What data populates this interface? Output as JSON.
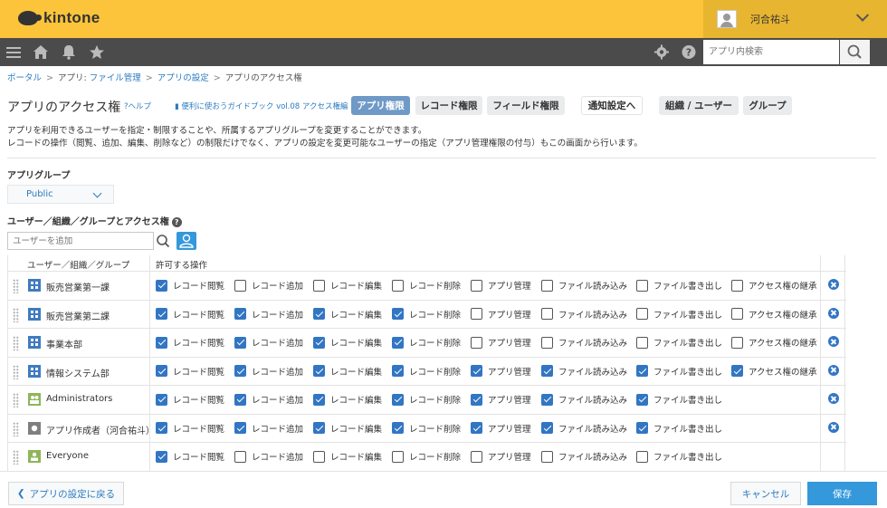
{
  "header": {
    "logo_text": "kintone",
    "user_name": "河合祐斗",
    "search_placeholder": "アプリ内検索"
  },
  "icons": [
    "menu-icon",
    "home-icon",
    "bell-icon",
    "star-icon",
    "gear-icon",
    "help-icon",
    "search-icon",
    "chevron-down-icon",
    "user-avatar-icon"
  ],
  "breadcrumb": {
    "portal": "ポータル",
    "app_prefix": "アプリ:",
    "app_name": "ファイル管理",
    "settings": "アプリの設定",
    "current": "アプリのアクセス権",
    "separator": ">"
  },
  "page": {
    "title": "アプリのアクセス権",
    "help": "?ヘルプ",
    "guide": "便利に使おうガイドブック vol.08 アクセス権編",
    "description_line1": "アプリを利用できるユーザーを指定・制限することや、所属するアプリグループを変更することができます。",
    "description_line2": "レコードの操作（閲覧、追加、編集、削除など）の制限だけでなく、アプリの設定を変更可能なユーザーの指定（アプリ管理権限の付与）もこの画面から行います。"
  },
  "tabs": [
    {
      "label": "アプリ権限",
      "active": true
    },
    {
      "label": "レコード権限",
      "active": false
    },
    {
      "label": "フィールド権限",
      "active": false
    },
    {
      "label": "通知設定へ",
      "active": false
    },
    {
      "label": "組織 / ユーザー",
      "active": false
    },
    {
      "label": "グループ",
      "active": false
    }
  ],
  "app_group": {
    "label": "アプリグループ",
    "selected": "Public"
  },
  "acl": {
    "label": "ユーザー／組織／グループとアクセス権",
    "add_placeholder": "ユーザーを追加",
    "col_entity": "ユーザー／組織／グループ",
    "col_perms": "許可する操作",
    "permissions": [
      "レコード閲覧",
      "レコード追加",
      "レコード編集",
      "レコード削除",
      "アプリ管理",
      "ファイル読み込み",
      "ファイル書き出し",
      "アクセス権の継承"
    ],
    "rows": [
      {
        "name": "販売営業第一課",
        "type": "org",
        "checks": [
          true,
          false,
          false,
          false,
          false,
          false,
          false,
          false
        ],
        "inherit": true,
        "deletable": true
      },
      {
        "name": "販売営業第二課",
        "type": "org",
        "checks": [
          true,
          true,
          true,
          true,
          false,
          false,
          false,
          false
        ],
        "inherit": true,
        "deletable": true
      },
      {
        "name": "事業本部",
        "type": "org",
        "checks": [
          true,
          true,
          true,
          true,
          false,
          false,
          false,
          false
        ],
        "inherit": true,
        "deletable": true
      },
      {
        "name": "情報システム部",
        "type": "org",
        "checks": [
          true,
          true,
          true,
          true,
          true,
          true,
          true,
          true
        ],
        "inherit": true,
        "deletable": true
      },
      {
        "name": "Administrators",
        "type": "group",
        "checks": [
          true,
          true,
          true,
          true,
          true,
          true,
          true
        ],
        "inherit": false,
        "deletable": true
      },
      {
        "name": "アプリ作成者（河合祐斗）",
        "type": "creator",
        "checks": [
          true,
          true,
          true,
          true,
          true,
          true,
          true
        ],
        "inherit": false,
        "deletable": true
      },
      {
        "name": "Everyone",
        "type": "everyone",
        "checks": [
          true,
          false,
          false,
          false,
          false,
          false,
          false
        ],
        "inherit": false,
        "deletable": false
      }
    ]
  },
  "footer": {
    "back": "アプリの設定に戻る",
    "cancel": "キャンセル",
    "save": "保存"
  },
  "colors": {
    "header_yellow": "#fcc43a",
    "nav_dark": "#4b4b4b",
    "accent_blue": "#3498db",
    "checkbox_blue": "#3276c3",
    "active_tab": "#6f99c6"
  }
}
